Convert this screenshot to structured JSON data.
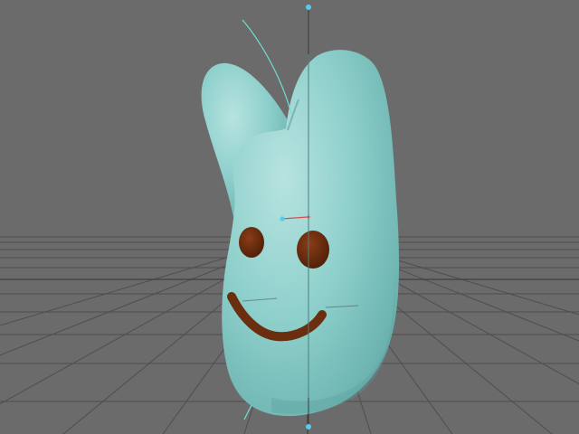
{
  "viewport": {
    "panel": "3d-perspective-viewport",
    "background_color": "#6b6b6b",
    "grid_color": "#4a4a4a",
    "manipulator_color": "#6fe0d0",
    "handle_color": "#55ccee"
  },
  "scene_object": {
    "kind": "rabbit-head-mesh",
    "body_color": "#83c9c6",
    "face_color": "#6b2e0f",
    "features": [
      "left-ear",
      "right-ear",
      "left-eye",
      "right-eye",
      "smile-mouth"
    ],
    "selected": true
  }
}
